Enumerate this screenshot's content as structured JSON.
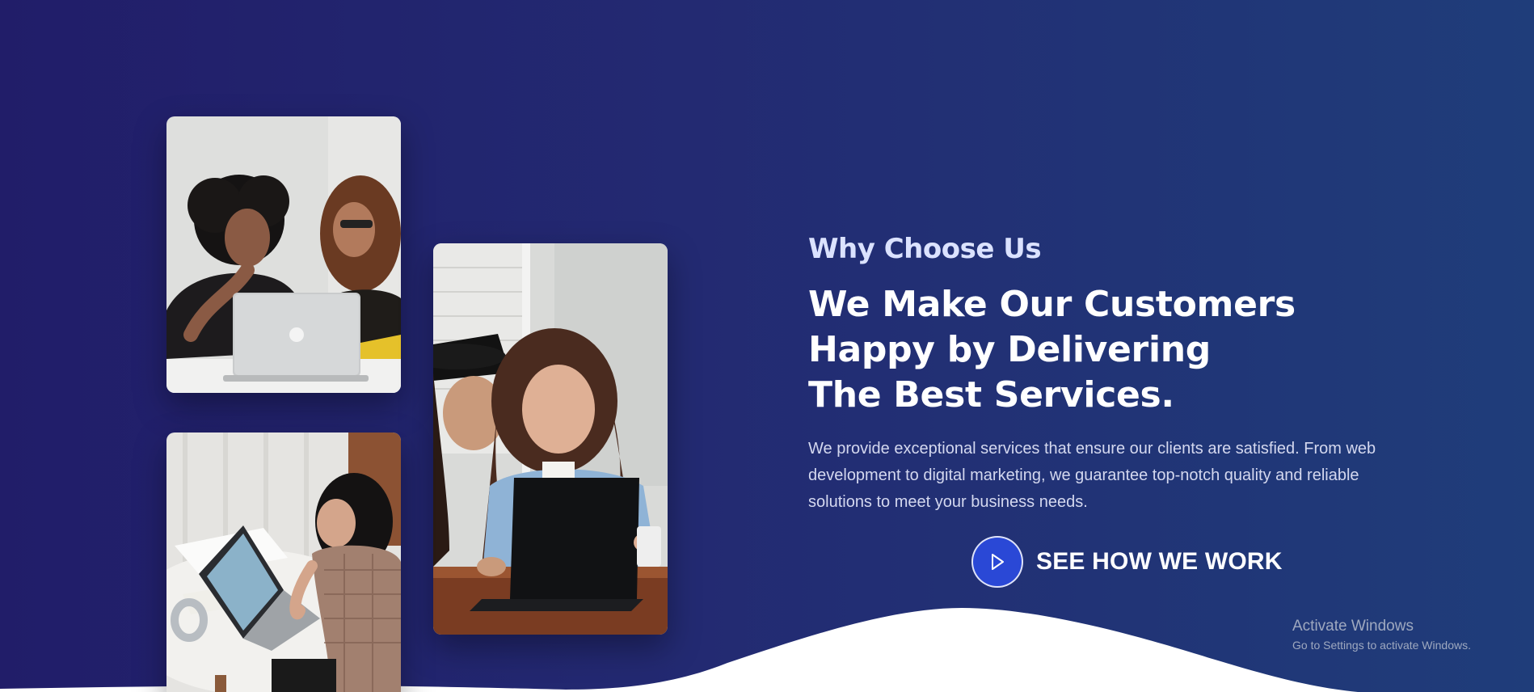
{
  "section": {
    "eyebrow": "Why Choose Us",
    "headline_lines": [
      "We Make Our Customers",
      "Happy by Delivering",
      "The Best Services."
    ],
    "description": "We provide exceptional services that ensure our clients are satisfied. From web development to digital marketing, we guarantee top-notch quality and reliable solutions to meet your business needs."
  },
  "cta": {
    "label": "SEE HOW WE WORK",
    "icon": "play-icon"
  },
  "images": [
    {
      "name": "photo-two-women-laptop",
      "alt": "Two women looking at a laptop"
    },
    {
      "name": "photo-women-chromebook",
      "alt": "Two women working on a laptop at a table"
    },
    {
      "name": "photo-woman-desk",
      "alt": "Woman working on laptop at a desk"
    }
  ],
  "watermark": {
    "title": "Activate Windows",
    "subtitle": "Go to Settings to activate Windows."
  },
  "colors": {
    "background_start": "#211d69",
    "background_end": "#1f3d7a",
    "accent": "#2a48d6",
    "eyebrow": "#dbe2ff",
    "wave": "#ffffff"
  }
}
